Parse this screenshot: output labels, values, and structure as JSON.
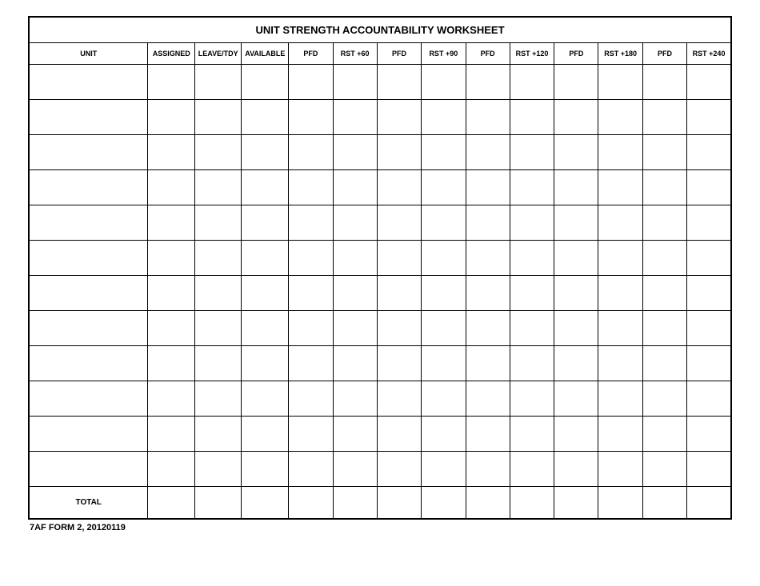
{
  "title": "UNIT STRENGTH ACCOUNTABILITY WORKSHEET",
  "columns": [
    "UNIT",
    "ASSIGNED",
    "LEAVE/TDY",
    "AVAILABLE",
    "PFD",
    "RST +60",
    "PFD",
    "RST +90",
    "PFD",
    "RST +120",
    "PFD",
    "RST +180",
    "PFD",
    "RST +240"
  ],
  "rows": [
    [
      "",
      "",
      "",
      "",
      "",
      "",
      "",
      "",
      "",
      "",
      "",
      "",
      "",
      ""
    ],
    [
      "",
      "",
      "",
      "",
      "",
      "",
      "",
      "",
      "",
      "",
      "",
      "",
      "",
      ""
    ],
    [
      "",
      "",
      "",
      "",
      "",
      "",
      "",
      "",
      "",
      "",
      "",
      "",
      "",
      ""
    ],
    [
      "",
      "",
      "",
      "",
      "",
      "",
      "",
      "",
      "",
      "",
      "",
      "",
      "",
      ""
    ],
    [
      "",
      "",
      "",
      "",
      "",
      "",
      "",
      "",
      "",
      "",
      "",
      "",
      "",
      ""
    ],
    [
      "",
      "",
      "",
      "",
      "",
      "",
      "",
      "",
      "",
      "",
      "",
      "",
      "",
      ""
    ],
    [
      "",
      "",
      "",
      "",
      "",
      "",
      "",
      "",
      "",
      "",
      "",
      "",
      "",
      ""
    ],
    [
      "",
      "",
      "",
      "",
      "",
      "",
      "",
      "",
      "",
      "",
      "",
      "",
      "",
      ""
    ],
    [
      "",
      "",
      "",
      "",
      "",
      "",
      "",
      "",
      "",
      "",
      "",
      "",
      "",
      ""
    ],
    [
      "",
      "",
      "",
      "",
      "",
      "",
      "",
      "",
      "",
      "",
      "",
      "",
      "",
      ""
    ],
    [
      "",
      "",
      "",
      "",
      "",
      "",
      "",
      "",
      "",
      "",
      "",
      "",
      "",
      ""
    ],
    [
      "",
      "",
      "",
      "",
      "",
      "",
      "",
      "",
      "",
      "",
      "",
      "",
      "",
      ""
    ]
  ],
  "total_label": "TOTAL",
  "total_row": [
    "",
    "",
    "",
    "",
    "",
    "",
    "",
    "",
    "",
    "",
    "",
    "",
    ""
  ],
  "footer": "7AF FORM 2, 20120119"
}
